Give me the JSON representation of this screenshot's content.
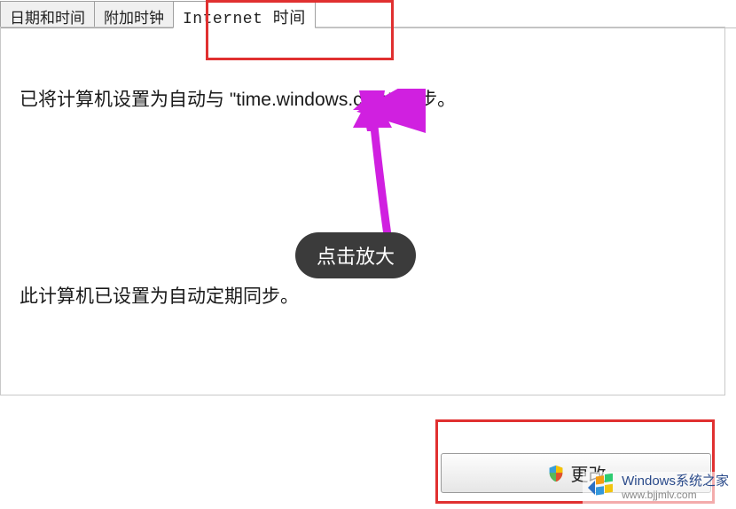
{
  "tabs": {
    "datetime": "日期和时间",
    "additional": "附加时钟",
    "internet": "Internet 时间"
  },
  "content": {
    "sync_status": "已将计算机设置为自动与 \"time.windows.com\" 同步。",
    "auto_sync_note": "此计算机已设置为自动定期同步。"
  },
  "tooltip": {
    "enlarge": "点击放大"
  },
  "button": {
    "change_settings": "更改"
  },
  "watermark": {
    "title": "Windows系统之家",
    "url": "www.bjjmlv.com"
  }
}
